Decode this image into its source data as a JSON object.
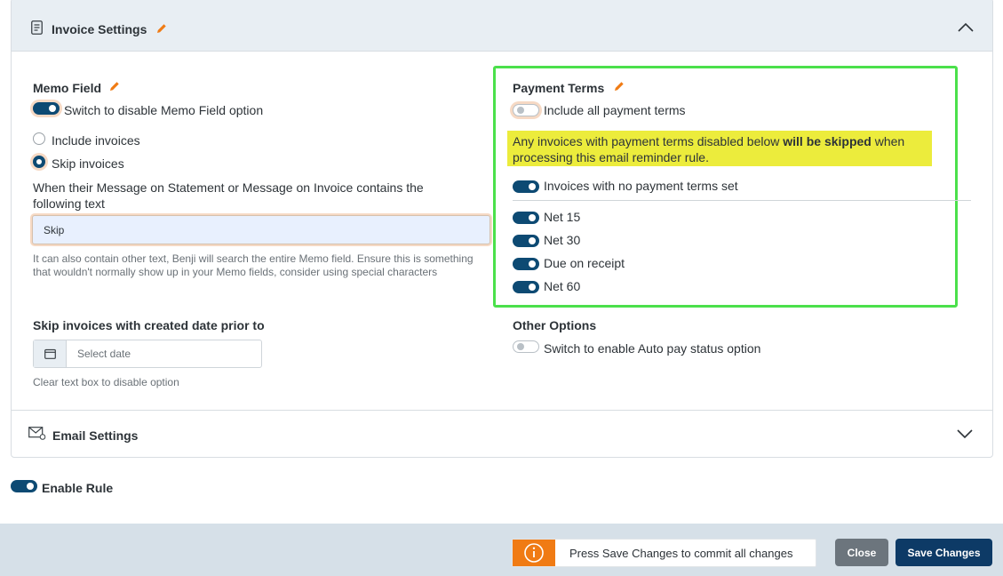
{
  "invoice_settings": {
    "title": "Invoice Settings"
  },
  "memo": {
    "title": "Memo Field",
    "toggle_label": "Switch to disable Memo Field option",
    "toggle_on": true,
    "radio_include_label": "Include invoices",
    "radio_skip_label": "Skip invoices",
    "selected": "skip",
    "contains_label": "When their Message on Statement or Message on Invoice contains the following text",
    "text_value": "Skip",
    "help_text": "It can also contain other text, Benji will search the entire Memo field. Ensure this is something that wouldn't normally show up in your Memo fields, consider using special characters"
  },
  "skip_date": {
    "title": "Skip invoices with created date prior to",
    "placeholder": "Select date",
    "help_text": "Clear text box to disable option"
  },
  "payment_terms": {
    "title": "Payment Terms",
    "include_all_label": "Include all payment terms",
    "include_all_on": false,
    "warning_pre": "Any invoices with payment terms disabled below ",
    "warning_bold": "will be skipped",
    "warning_post": " when processing this email reminder rule.",
    "no_terms_label": "Invoices with no payment terms set",
    "terms": [
      {
        "label": "Net 15",
        "on": true
      },
      {
        "label": "Net 30",
        "on": true
      },
      {
        "label": "Due on receipt",
        "on": true
      },
      {
        "label": "Net 60",
        "on": true
      }
    ]
  },
  "other_options": {
    "title": "Other Options",
    "autopay_label": "Switch to enable Auto pay status option",
    "autopay_on": false
  },
  "email_settings": {
    "title": "Email Settings"
  },
  "enable_rule": {
    "label": "Enable Rule",
    "on": true
  },
  "footer": {
    "notice_text": "Press Save Changes to commit all changes",
    "close_label": "Close",
    "save_label": "Save Changes"
  },
  "colors": {
    "toggle_on": "#0d4a73",
    "accent_orange": "#f07b14",
    "highlight_yellow": "#ecec3c",
    "green_outline": "#4be04b",
    "save_button": "#0d3a66",
    "close_button": "#6c757d"
  }
}
